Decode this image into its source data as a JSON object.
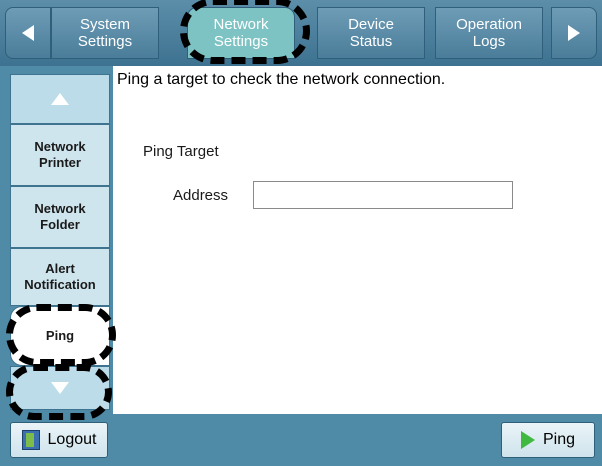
{
  "header": {
    "tabs": [
      {
        "label": "System\nSettings",
        "active": false
      },
      {
        "label": "Network\nSettings",
        "active": true
      },
      {
        "label": "Device\nStatus",
        "active": false
      },
      {
        "label": "Operation\nLogs",
        "active": false
      }
    ]
  },
  "sidebar": {
    "items": [
      {
        "label": "Network\nPrinter"
      },
      {
        "label": "Network\nFolder"
      },
      {
        "label": "Alert\nNotification"
      },
      {
        "label": "Ping",
        "active": true
      }
    ]
  },
  "main": {
    "description": "Ping a target to check the network connection.",
    "section_label": "Ping Target",
    "address_label": "Address",
    "address_value": ""
  },
  "footer": {
    "logout_label": "Logout",
    "ping_label": "Ping"
  },
  "colors": {
    "bar": "#4f8aa6",
    "active_tab": "#7ec3c4",
    "side_item": "#cfe5ee"
  }
}
